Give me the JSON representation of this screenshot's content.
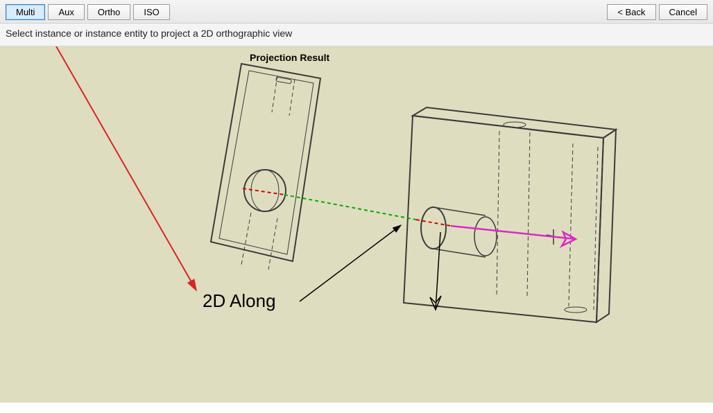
{
  "toolbar": {
    "left": [
      {
        "label": "Multi",
        "active": true
      },
      {
        "label": "Aux",
        "active": false
      },
      {
        "label": "Ortho",
        "active": false
      },
      {
        "label": "ISO",
        "active": false
      }
    ],
    "right": [
      {
        "label": "< Back"
      },
      {
        "label": "Cancel"
      }
    ]
  },
  "instruction": "Select instance or instance entity to project a 2D orthographic view",
  "viewport": {
    "projection_title": "Projection Result",
    "annotation": "2D Along"
  }
}
